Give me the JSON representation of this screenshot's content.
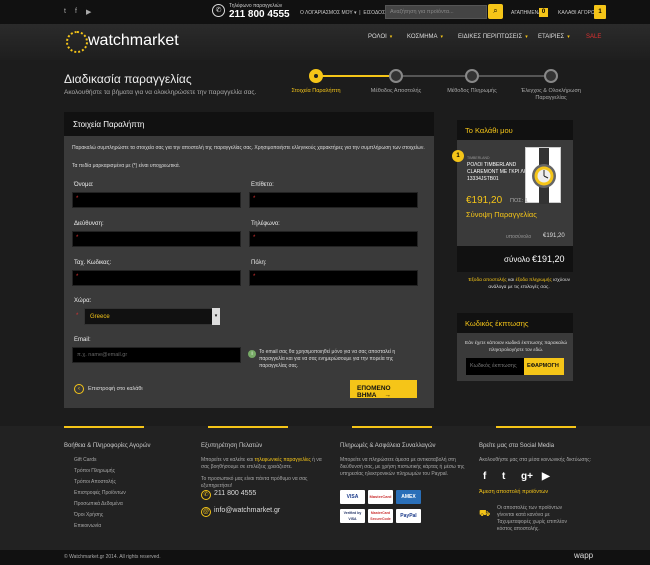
{
  "topbar": {
    "phone_caption": "Τηλέφωνο παραγγελιών",
    "phone": "211 800 4555",
    "account": "Ο ΛΟΓΑΡΙΑΣΜΟΣ ΜΟΥ",
    "login": "ΕΙΣΟΔΟΣ",
    "search_placeholder": "Αναζήτηση για προϊόντα...",
    "wishlist": "ΑΓΑΠΗΜΕΝΑ",
    "wishlist_count": "0",
    "cart": "ΚΑΛΑΘΙ ΑΓΟΡΩΝ",
    "cart_count": "1"
  },
  "brand": {
    "logo": "watchmarket"
  },
  "nav": [
    "ΡΟΛΟΙ",
    "ΚΟΣΜΗΜΑ",
    "ΕΙΔΙΚΕΣ ΠΕΡΙΠΤΩΣΕΙΣ",
    "ΕΤΑΙΡΙΕΣ",
    "SALE"
  ],
  "page": {
    "title": "Διαδικασία παραγγελίας",
    "subtitle": "Ακολουθήστε τα βήματα για να ολοκληρώσετε την παραγγελία σας."
  },
  "steps": [
    "Στοιχεία Παραλήπτη",
    "Μέθοδος Αποστολής",
    "Μέθοδος Πληρωμής",
    "Έλεγχος & Ολοκλήρωση Παραγγελίας"
  ],
  "form": {
    "title": "Στοιχεία Παραλήπτη",
    "intro": "Παρακαλώ συμπληρώστε τα στοιχεία σας για την αποστολή της παραγγελίας σας. Χρησιμοποιήστε ελληνικούς χαρακτήρες για την συμπλήρωση των στοιχείων.",
    "required_note": "Τα πεδία μαρκαρισμένα με (*) είναι υποχρεωτικά.",
    "first_name": "Όνομα:",
    "last_name": "Επίθετο:",
    "address": "Διεύθυνση:",
    "phone": "Τηλέφωνο:",
    "zip": "Ταχ. Κωδικας:",
    "city": "Πόλη:",
    "country_label": "Χώρα:",
    "country_value": "Greece",
    "email_label": "Email:",
    "email_placeholder": "π.χ. name@email.gr",
    "email_note": "Το email σας θα χρησιμοποιηθεί μόνο για να σας αποσταλεί η παραγγελία και για να σας ενημερώσουμε για την πορεία της παραγγελίας σας.",
    "back": "Επιστροφή στο καλάθι",
    "next": "ΕΠΟΜΕΝΟ ΒΗΜΑ"
  },
  "cart_panel": {
    "title": "Το Καλάθι μου",
    "item_count": "1",
    "item_brand": "TIMBERLAND",
    "item_name_1": "ΡΟΛΟΙ TIMBERLAND",
    "item_name_2": "CLAREMONT ΜΕ ΓΚΡΙ ΛΟΥΡΑΚΙ",
    "item_code": "13334JSTB01",
    "price": "€191,20",
    "qty": "ΠΟΣ: 1",
    "summary_title": "Σύνοψη Παραγγελίας",
    "subtotal_label": "υποσύνολο",
    "subtotal": "€191,20",
    "total_label": "σύνολο",
    "total": "€191,20",
    "note_1": "Έξοδα αποστολής",
    "note_and": "και",
    "note_2": "έξοδα πληρωμής",
    "note_rest": "ισχύουν ανάλογα με τις επιλογές σας."
  },
  "discount": {
    "title": "Κωδικός έκπτωσης",
    "text": "Εάν έχετε κάποιον κωδικό έκπτωσης παρακαλώ πληκτρολογήστε τον εδώ.",
    "placeholder": "Κωδικός έκπτωσης",
    "button": "ΕΦΑΡΜΟΓΗ"
  },
  "footer": {
    "col1_title": "Βοήθεια & Πληροφορίες Αγορών",
    "col1_links": [
      "Gift Cards",
      "Τρόποι Πληρωμής",
      "Τρόποι Αποστολής",
      "Επιστροφές Προϊόντων",
      "Προσωπικά Δεδομένα",
      "Όροι Χρήσης",
      "Επικοινωνία"
    ],
    "col2_title": "Εξυπηρέτηση Πελατών",
    "col2_text_a": "Μπορείτε να καλείτε και",
    "col2_link": "τηλεφωνικές παραγγελίες",
    "col2_text_b": "ή να σας βοηθήσουμε σε επιλέξεις χρειάζεστε.",
    "col2_text_c": "Το προσωπικό μας είναι πάντα πρόθυμο να σας εξυπηρετήσει!",
    "phone": "211 800 4555",
    "email": "info@watchmarket.gr",
    "col3_title": "Πληρωμές & Ασφάλεια Συναλλαγών",
    "col3_text": "Μπορείτε να πληρώσετε άμεσα με αντικαταβολή στη διεύθυνσή σας, με χρήση πιστωτικής κάρτας ή μέσω της υπηρεσίας ηλεκτρονικών πληρωμών του Paypal.",
    "pay": [
      "VISA",
      "MasterCard",
      "AMEX",
      "Verified by VISA",
      "MasterCard SecureCode",
      "PayPal"
    ],
    "col4_title": "Βρείτε μας στα Social Media",
    "col4_text": "Ακολουθήστε μας στα μέσα κοινωνικής δικτύωσης:",
    "social": [
      "f",
      "t",
      "g+",
      "▶"
    ],
    "shipping_title": "Άμεση αποστολή προϊόντων",
    "shipping_text": "Οι αποστολές των προϊόντων γίνονται κατά κανόνα με Ταχυμεταφορές χωρίς επιπλέον κόστος αποστολής."
  },
  "copyright": "© Watchmarket.gr 2014. All rights reserved.",
  "credit": "wapp"
}
